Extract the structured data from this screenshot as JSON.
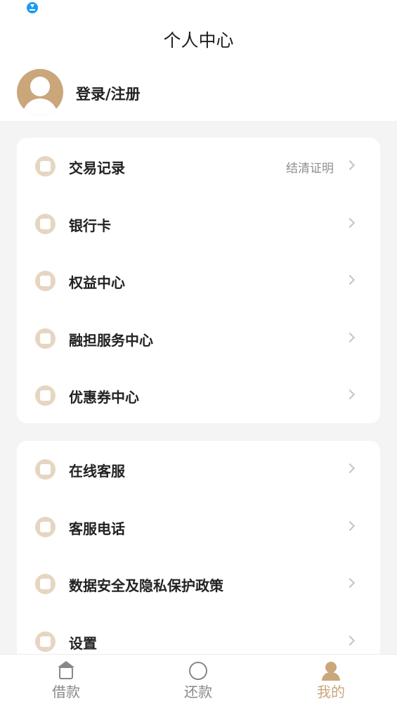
{
  "header": {
    "title": "个人中心",
    "login_label": "登录/注册"
  },
  "menu_group_1": [
    {
      "label": "交易记录",
      "sub": "结清证明",
      "icon": "document-icon"
    },
    {
      "label": "银行卡",
      "sub": "",
      "icon": "bank-card-icon"
    },
    {
      "label": "权益中心",
      "sub": "",
      "icon": "benefits-icon"
    },
    {
      "label": "融担服务中心",
      "sub": "",
      "icon": "diamond-icon"
    },
    {
      "label": "优惠券中心",
      "sub": "",
      "icon": "coupon-icon"
    }
  ],
  "menu_group_2": [
    {
      "label": "在线客服",
      "icon": "chat-icon"
    },
    {
      "label": "客服电话",
      "icon": "phone-icon"
    },
    {
      "label": "数据安全及隐私保护政策",
      "icon": "shield-icon"
    },
    {
      "label": "设置",
      "icon": "gear-icon"
    }
  ],
  "tabbar": {
    "tabs": [
      {
        "label": "借款",
        "icon": "home-yen-icon",
        "active": false
      },
      {
        "label": "还款",
        "icon": "repay-icon",
        "active": false
      },
      {
        "label": "我的",
        "icon": "user-icon",
        "active": true
      }
    ]
  },
  "colors": {
    "accent": "#c9a77a",
    "icon_bg": "#e6d6c1",
    "page_bg": "#f4f4f4",
    "status_download": "#1a9cf0"
  }
}
